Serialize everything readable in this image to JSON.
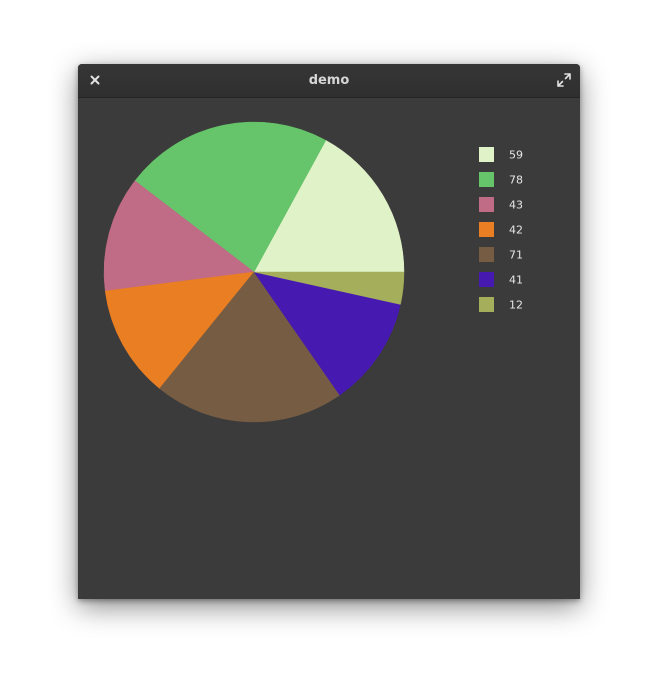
{
  "window": {
    "title": "demo",
    "close_icon": "close-icon",
    "maximize_icon": "maximize-icon"
  },
  "chart_data": {
    "type": "pie",
    "title": "",
    "start_angle_deg": 0,
    "direction": "counterclockwise",
    "legend_position": "right",
    "slices": [
      {
        "label": "59",
        "value": 59,
        "color": "#e0f2c8"
      },
      {
        "label": "78",
        "value": 78,
        "color": "#66c46a"
      },
      {
        "label": "43",
        "value": 43,
        "color": "#c16c87"
      },
      {
        "label": "42",
        "value": 42,
        "color": "#ea7e22"
      },
      {
        "label": "71",
        "value": 71,
        "color": "#775c44"
      },
      {
        "label": "41",
        "value": 41,
        "color": "#4619b0"
      },
      {
        "label": "12",
        "value": 12,
        "color": "#a5ae5b"
      }
    ]
  }
}
